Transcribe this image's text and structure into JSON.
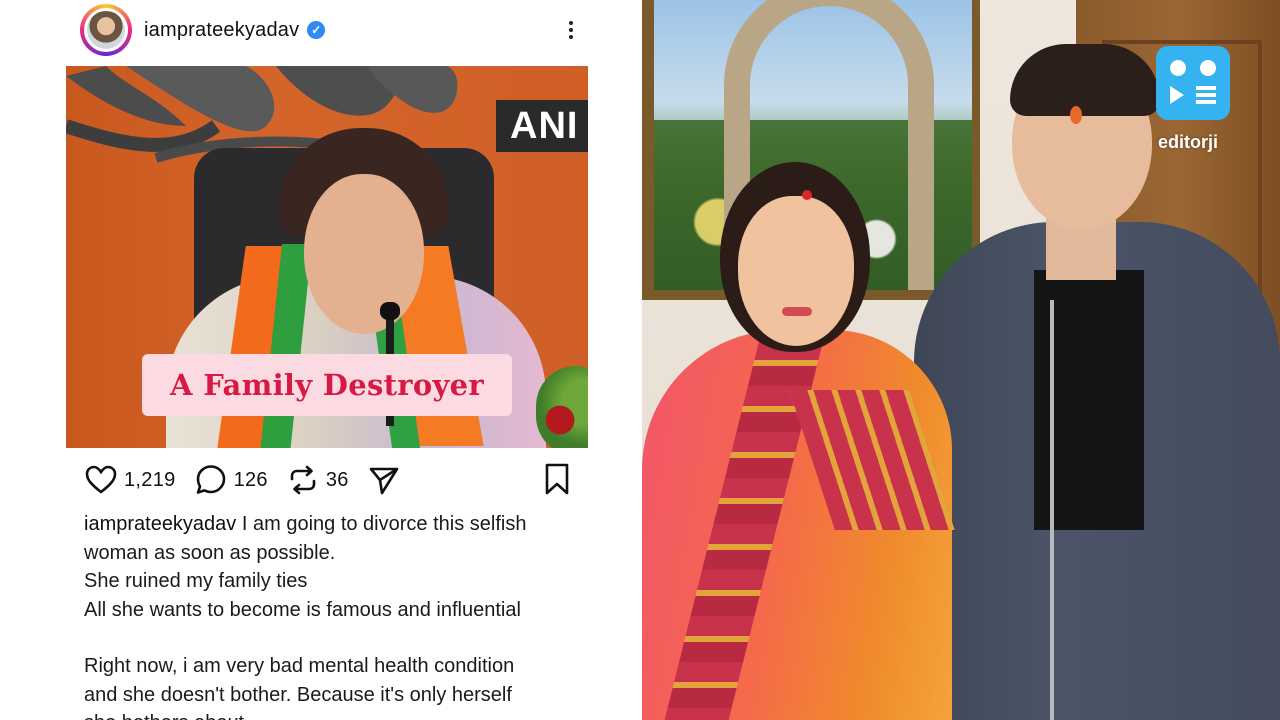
{
  "post": {
    "username": "iamprateekyadav",
    "verified": true,
    "image": {
      "channel_tag": "ANI",
      "overlay_text": "A Family Destroyer"
    },
    "actions": {
      "likes": "1,219",
      "comments": "126",
      "reposts": "36"
    },
    "caption": {
      "author": "iamprateekyadav",
      "lines": [
        "I am going to divorce this selfish",
        "woman as soon as possible.",
        "She ruined my family ties",
        "All she wants to become is famous and influential",
        "Right now, i am very bad mental health condition",
        "and she doesn't bother. Because it's only herself",
        "she bothers about"
      ]
    }
  },
  "watermark": {
    "brand_name": "editorji",
    "brand_color": "#35b2f0"
  },
  "colors": {
    "verified_badge": "#2f8cf0",
    "overlay_text": "#d61a45",
    "overlay_bg": "#fbdbe1"
  }
}
